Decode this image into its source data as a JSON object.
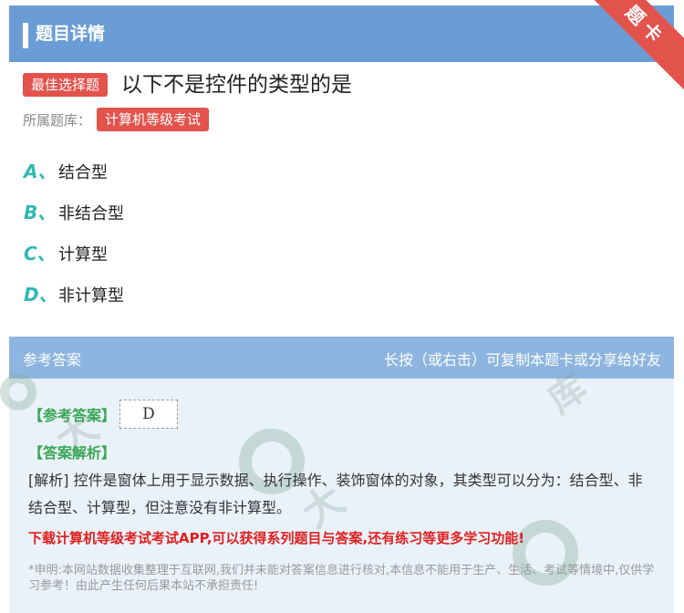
{
  "header": {
    "title": "题目详情"
  },
  "ribbon": {
    "label": "题卡"
  },
  "question": {
    "type_badge": "最佳选择题",
    "text": "以下不是控件的类型的是",
    "bank_label": "所属题库：",
    "bank_name": "计算机等级考试"
  },
  "options": [
    {
      "letter": "A、",
      "text": "结合型"
    },
    {
      "letter": "B、",
      "text": "非结合型"
    },
    {
      "letter": "C、",
      "text": "计算型"
    },
    {
      "letter": "D、",
      "text": "非计算型"
    }
  ],
  "answer_section": {
    "header_left": "参考答案",
    "header_right": "长按（或右击）可复制本题卡或分享给好友",
    "ref_answer_title": "【参考答案】",
    "ref_answer_value": "D",
    "analysis_title": "【答案解析】",
    "analysis_text": "[解析] 控件是窗体上用于显示数据、执行操作、装饰窗体的对象，其类型可以分为：结合型、非结合型、计算型，但注意没有非计算型。",
    "promo": "下载计算机等级考试考试APP,可以获得系列题目与答案,还有练习等更多学习功能!",
    "disclaimer": "*申明:本网站数据收集整理于互联网,我们并未能对答案信息进行核对,本信息不能用于生产、生活、考试等情境中,仅供学习参考！由此产生任何后果本站不承担责任!"
  },
  "colors": {
    "header_bg": "#6a9dd5",
    "accent_red": "#e2534c",
    "option_letter": "#2fb8b5",
    "answer_green": "#3aa655",
    "promo_red": "#e01f1f"
  }
}
